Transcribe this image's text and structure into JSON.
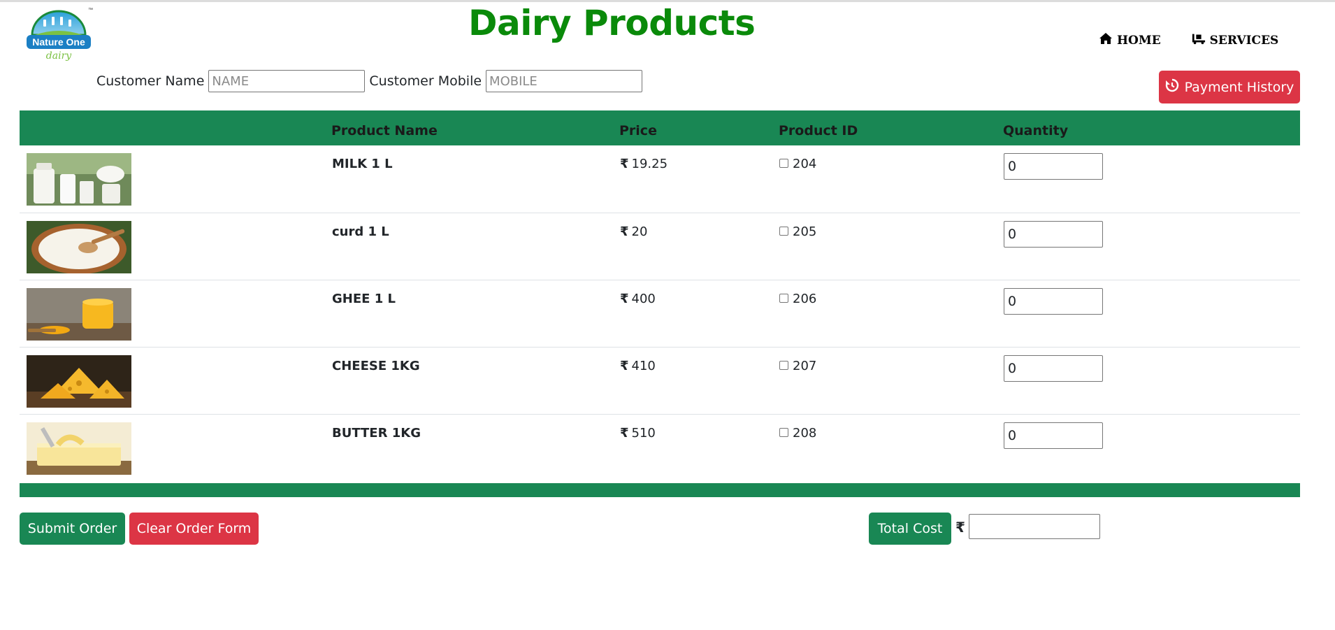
{
  "header": {
    "title": "Dairy Products",
    "logo_text": "Nature One",
    "logo_subtext": "dairy",
    "logo_tm": "™"
  },
  "nav": {
    "home_label": "HOME",
    "services_label": "SERVICES"
  },
  "customer": {
    "name_label": "Customer Name",
    "name_placeholder": "NAME",
    "name_value": "",
    "mobile_label": "Customer Mobile",
    "mobile_placeholder": "MOBILE",
    "mobile_value": ""
  },
  "payment_history_label": "Payment History",
  "table": {
    "columns": [
      "",
      "Product Name",
      "Price",
      "Product ID",
      "Quantity"
    ],
    "currency_symbol": "₹",
    "rows": [
      {
        "image": "milk-image",
        "name": "MILK 1 L",
        "price": "19.25",
        "product_id": "204",
        "checked": false,
        "quantity": "0"
      },
      {
        "image": "curd-image",
        "name": "curd 1 L",
        "price": "20",
        "product_id": "205",
        "checked": false,
        "quantity": "0"
      },
      {
        "image": "ghee-image",
        "name": "GHEE 1 L",
        "price": "400",
        "product_id": "206",
        "checked": false,
        "quantity": "0"
      },
      {
        "image": "cheese-image",
        "name": "CHEESE 1KG",
        "price": "410",
        "product_id": "207",
        "checked": false,
        "quantity": "0"
      },
      {
        "image": "butter-image",
        "name": "BUTTER 1KG",
        "price": "510",
        "product_id": "208",
        "checked": false,
        "quantity": "0"
      }
    ]
  },
  "actions": {
    "submit_label": "Submit Order",
    "clear_label": "Clear Order Form",
    "total_label": "Total Cost",
    "total_currency": "₹",
    "total_value": ""
  },
  "colors": {
    "title_green": "#0a8a0a",
    "table_green": "#198754",
    "danger_red": "#dc3545"
  }
}
